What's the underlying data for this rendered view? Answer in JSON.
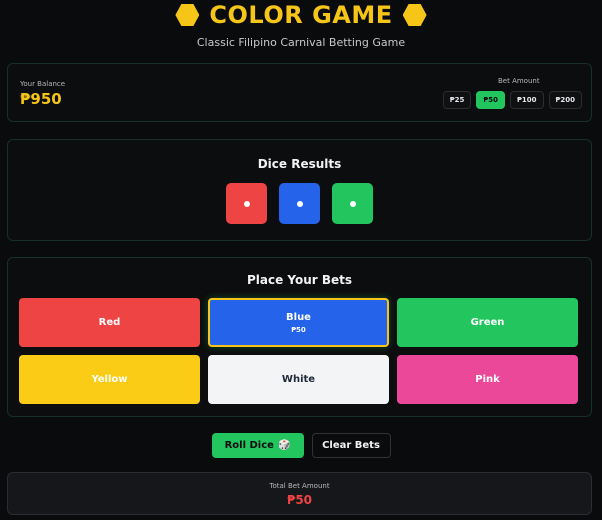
{
  "header": {
    "title": "COLOR GAME",
    "subtitle": "Classic Filipino Carnival Betting Game",
    "icon": "hexagon-icon"
  },
  "balance": {
    "label": "Your Balance",
    "value": "₱950"
  },
  "bet_amount": {
    "label": "Bet Amount",
    "options": [
      "₱25",
      "₱50",
      "₱100",
      "₱200"
    ],
    "selected": "₱50"
  },
  "dice": {
    "title": "Dice Results",
    "results": [
      {
        "color": "#ef4444"
      },
      {
        "color": "#2563eb"
      },
      {
        "color": "#22c55e"
      }
    ]
  },
  "bets": {
    "title": "Place Your Bets",
    "options": [
      {
        "label": "Red",
        "amount": "",
        "color": "#ef4444",
        "text_color": "#ffffff"
      },
      {
        "label": "Blue",
        "amount": "₱50",
        "color": "#2563eb",
        "text_color": "#ffffff"
      },
      {
        "label": "Green",
        "amount": "",
        "color": "#22c55e",
        "text_color": "#ffffff"
      },
      {
        "label": "Yellow",
        "amount": "",
        "color": "#facc15",
        "text_color": "#ffffff"
      },
      {
        "label": "White",
        "amount": "",
        "color": "#f3f4f6",
        "text_color": "#1f2937"
      },
      {
        "label": "Pink",
        "amount": "",
        "color": "#ec4899",
        "text_color": "#ffffff"
      }
    ]
  },
  "actions": {
    "roll_label": "Roll Dice",
    "roll_icon": "🎲",
    "clear_label": "Clear Bets"
  },
  "total": {
    "label": "Total Bet Amount",
    "value": "₱50"
  }
}
